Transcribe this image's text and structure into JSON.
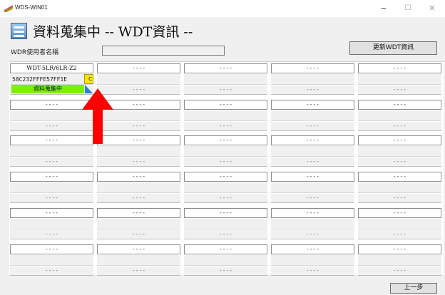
{
  "window": {
    "title": "WDS-WIN01",
    "controls": {
      "minimize": "−",
      "maximize": "☐",
      "close": "✕"
    }
  },
  "header": {
    "title": "資料蒐集中 -- WDT資訊 --",
    "icon": "data-collection-icon"
  },
  "user": {
    "label": "WDR使用者名稱",
    "value": ""
  },
  "buttons": {
    "update": "更新WDT資訊",
    "back": "上一步"
  },
  "device": {
    "model": "WDT-5LR/6LR-Z2",
    "id": "58C232FFFE57FF1E",
    "status": "資料蒐集中",
    "status_color": "#7cf000",
    "yellow_label": "C"
  },
  "empty_slot_text": "----",
  "grid": {
    "rows": 6,
    "cols": 5
  },
  "annotation": {
    "arrow_color": "#ff0000"
  }
}
